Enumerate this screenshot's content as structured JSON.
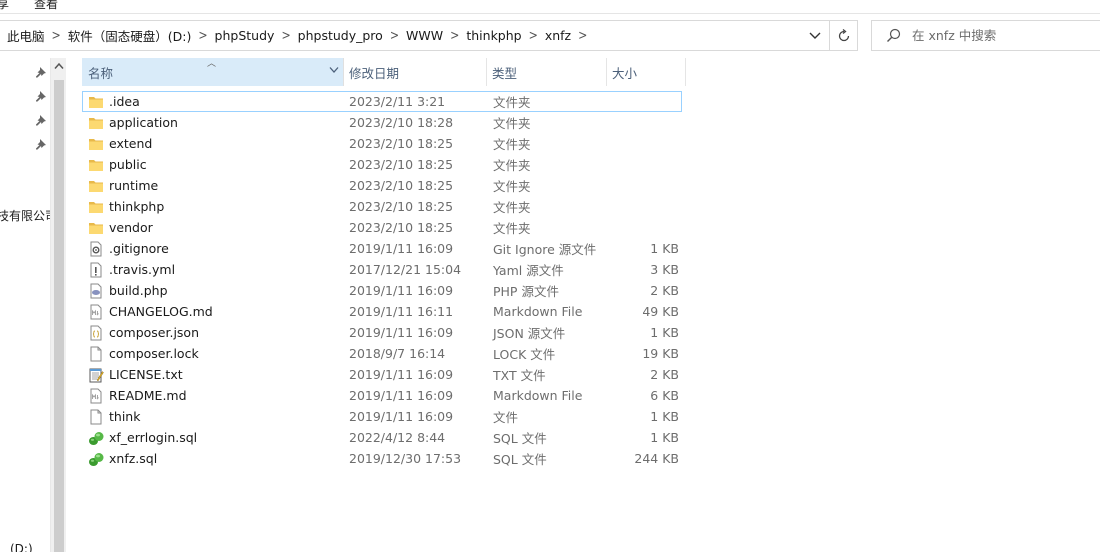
{
  "menu": {
    "left_fragment": "享",
    "view": "查看"
  },
  "breadcrumb": [
    "此电脑",
    "软件（固态硬盘）(D:)",
    "phpStudy",
    "phpstudy_pro",
    "WWW",
    "thinkphp",
    "xnfz"
  ],
  "search": {
    "placeholder": "在 xnfz 中搜索"
  },
  "nav": {
    "company_fragment": "技有限公司",
    "drive_fragment": "(D:)"
  },
  "columns": {
    "name": "名称",
    "date": "修改日期",
    "type": "类型",
    "size": "大小"
  },
  "files": [
    {
      "icon": "folder-icon",
      "name": ".idea",
      "date": "2023/2/11 3:21",
      "type": "文件夹",
      "size": ""
    },
    {
      "icon": "folder-icon",
      "name": "application",
      "date": "2023/2/10 18:28",
      "type": "文件夹",
      "size": ""
    },
    {
      "icon": "folder-icon",
      "name": "extend",
      "date": "2023/2/10 18:25",
      "type": "文件夹",
      "size": ""
    },
    {
      "icon": "folder-icon",
      "name": "public",
      "date": "2023/2/10 18:25",
      "type": "文件夹",
      "size": ""
    },
    {
      "icon": "folder-icon",
      "name": "runtime",
      "date": "2023/2/10 18:25",
      "type": "文件夹",
      "size": ""
    },
    {
      "icon": "folder-icon",
      "name": "thinkphp",
      "date": "2023/2/10 18:25",
      "type": "文件夹",
      "size": ""
    },
    {
      "icon": "folder-icon",
      "name": "vendor",
      "date": "2023/2/10 18:25",
      "type": "文件夹",
      "size": ""
    },
    {
      "icon": "gear-file-icon",
      "name": ".gitignore",
      "date": "2019/1/11 16:09",
      "type": "Git Ignore 源文件",
      "size": "1 KB"
    },
    {
      "icon": "yaml-file-icon",
      "name": ".travis.yml",
      "date": "2017/12/21 15:04",
      "type": "Yaml 源文件",
      "size": "3 KB"
    },
    {
      "icon": "php-file-icon",
      "name": "build.php",
      "date": "2019/1/11 16:09",
      "type": "PHP 源文件",
      "size": "2 KB"
    },
    {
      "icon": "markdown-file-icon",
      "name": "CHANGELOG.md",
      "date": "2019/1/11 16:11",
      "type": "Markdown File",
      "size": "49 KB"
    },
    {
      "icon": "json-file-icon",
      "name": "composer.json",
      "date": "2019/1/11 16:09",
      "type": "JSON 源文件",
      "size": "1 KB"
    },
    {
      "icon": "blank-file-icon",
      "name": "composer.lock",
      "date": "2018/9/7 16:14",
      "type": "LOCK 文件",
      "size": "19 KB"
    },
    {
      "icon": "text-file-icon",
      "name": "LICENSE.txt",
      "date": "2019/1/11 16:09",
      "type": "TXT 文件",
      "size": "2 KB"
    },
    {
      "icon": "markdown-file-icon",
      "name": "README.md",
      "date": "2019/1/11 16:09",
      "type": "Markdown File",
      "size": "6 KB"
    },
    {
      "icon": "blank-file-icon",
      "name": "think",
      "date": "2019/1/11 16:09",
      "type": "文件",
      "size": "1 KB"
    },
    {
      "icon": "sql-file-icon",
      "name": "xf_errlogin.sql",
      "date": "2022/4/12 8:44",
      "type": "SQL 文件",
      "size": "1 KB"
    },
    {
      "icon": "sql-file-icon",
      "name": "xnfz.sql",
      "date": "2019/12/30 17:53",
      "type": "SQL 文件",
      "size": "244 KB"
    }
  ]
}
